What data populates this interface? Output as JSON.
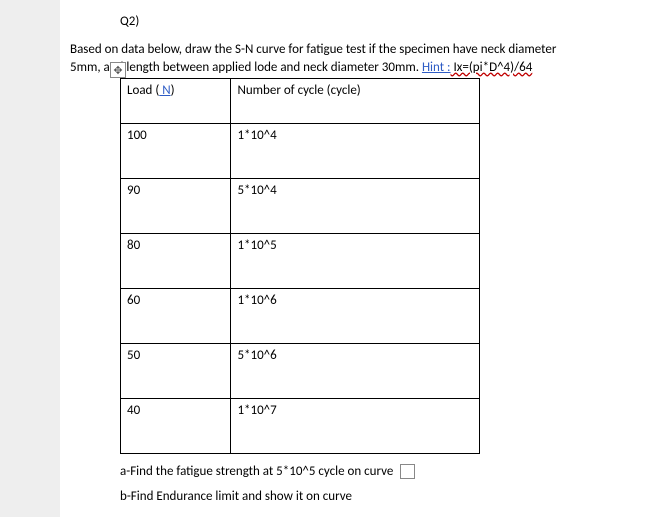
{
  "question": {
    "label": "Q2)",
    "text_line1": "Based on data below, draw the S-N curve for fatigue test if the specimen have neck diameter",
    "text_line2_lead": "5mm, and length between applied lode and neck diameter 30mm. ",
    "hint_label": "Hint :",
    "hint_formula": " Ix=(pi*D^4)/64"
  },
  "table": {
    "headers": {
      "load_prefix": "Load (",
      "load_n": " N",
      "load_suffix": ")",
      "cycles": "Number of cycle (cycle)"
    },
    "rows": [
      {
        "load": "100",
        "cycles": "1*10^4"
      },
      {
        "load": "90",
        "cycles": "5*10^4"
      },
      {
        "load": "80",
        "cycles": "1*10^5"
      },
      {
        "load": "60",
        "cycles": "1*10^6"
      },
      {
        "load": "50",
        "cycles": "5*10^6"
      },
      {
        "load": "40",
        "cycles": "1*10^7"
      }
    ]
  },
  "sub_questions": {
    "a": "a-Find the fatigue strength at 5*10^5 cycle on curve",
    "b": "b-Find Endurance limit and show it on curve"
  },
  "anchor_glyph": "✥"
}
